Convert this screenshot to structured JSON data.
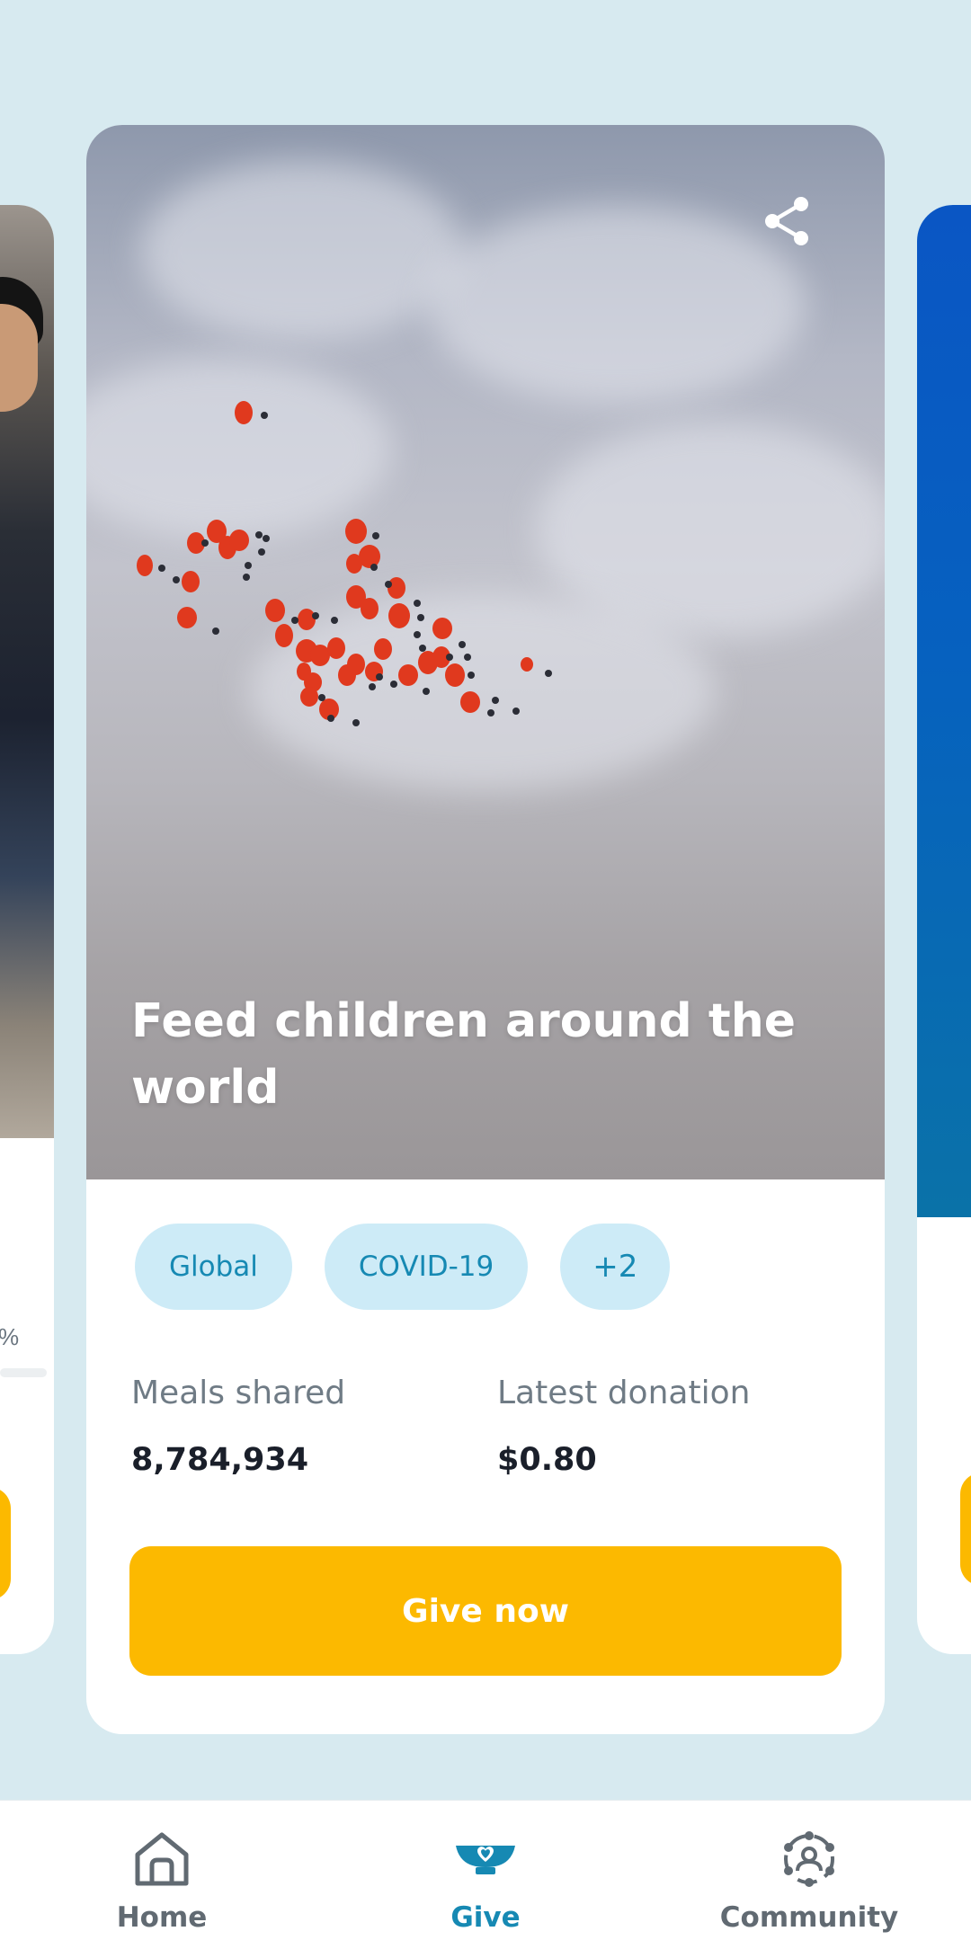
{
  "card": {
    "title": "Feed children around the world",
    "tags": [
      "Global",
      "COVID-19"
    ],
    "more_tags": "+2",
    "stats": {
      "meals_label": "Meals shared",
      "meals_value": "8,784,934",
      "latest_label": "Latest donation",
      "latest_value": "$0.80"
    },
    "give_label": "Give now",
    "share_icon": "share-icon"
  },
  "left_peek": {
    "percent_fragment": "%"
  },
  "bottom_nav": {
    "items": [
      {
        "label": "Home",
        "icon": "home-icon"
      },
      {
        "label": "Give",
        "icon": "give-bowl-heart-icon"
      },
      {
        "label": "Community",
        "icon": "community-icon"
      }
    ],
    "active": "Give"
  },
  "colors": {
    "background": "#d7eaf0",
    "accent_yellow": "#fcb900",
    "accent_blue": "#1689b3",
    "tag_bg": "#cdebf7"
  }
}
